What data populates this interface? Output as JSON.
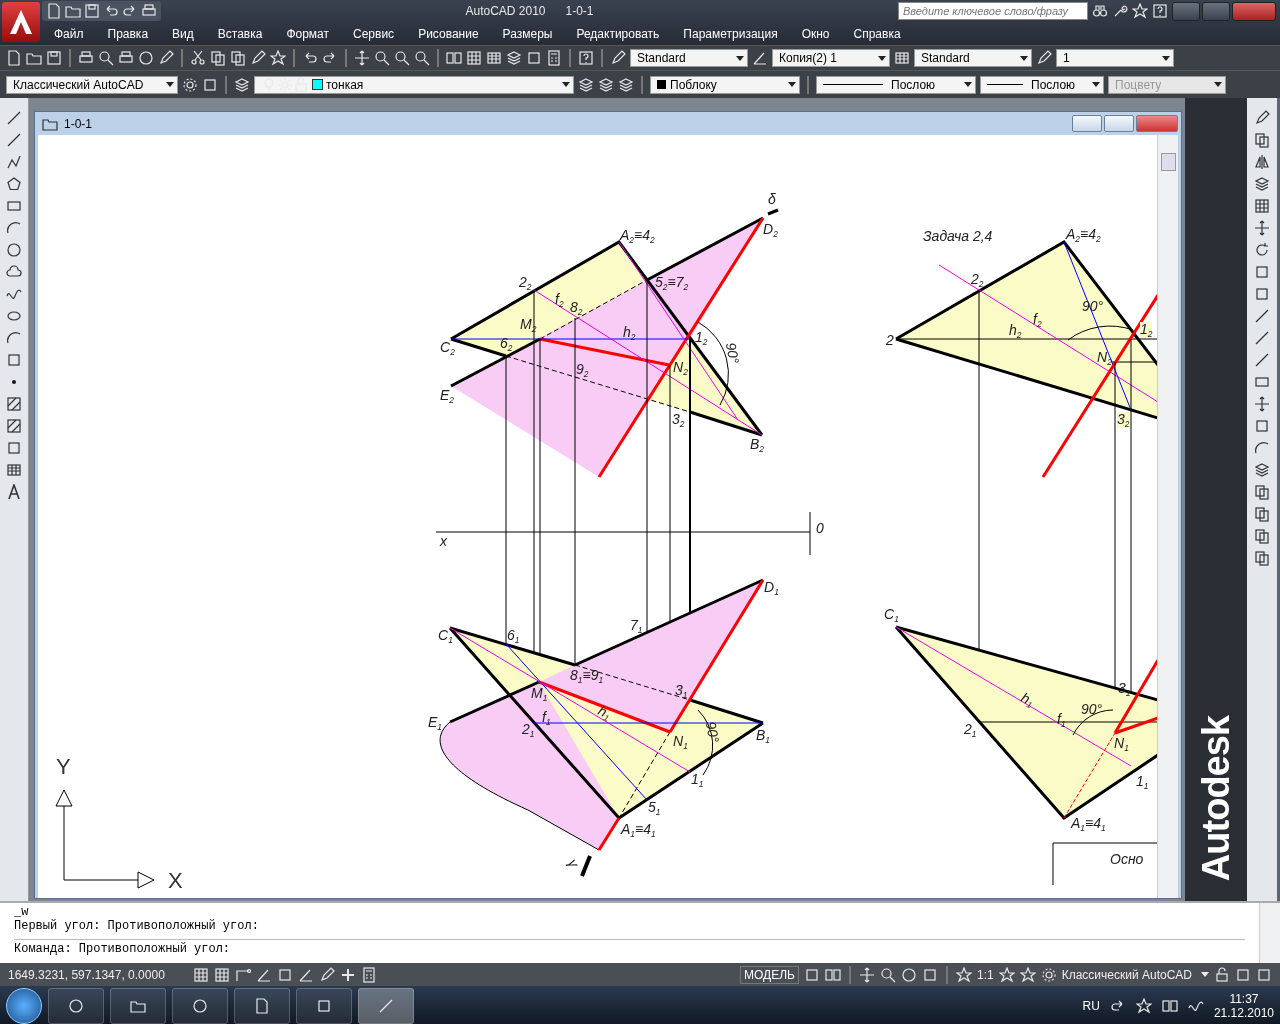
{
  "title_bar": {
    "title": "AutoCAD 2010",
    "document": "1-0-1",
    "search": {
      "placeholder": "Введите ключевое слово/фразу"
    }
  },
  "menu": [
    "Файл",
    "Правка",
    "Вид",
    "Вставка",
    "Формат",
    "Сервис",
    "Рисование",
    "Размеры",
    "Редактировать",
    "Параметризация",
    "Окно",
    "Справка"
  ],
  "styles_toolbar": {
    "text_style": "Standard",
    "dim_style": "Копия(2) 1",
    "table_style": "Standard",
    "multileader_scale": "1"
  },
  "properties_toolbar": {
    "workspace": "Классический AutoCAD",
    "layer": "тонкая",
    "object_color": "Поблоку",
    "linetype": "Послою",
    "lineweight": "Послою",
    "plot_style": {
      "value": "Поцвету",
      "disabled": true
    }
  },
  "drawing_window": {
    "title": "1-0-1",
    "labels": [
      "δ",
      "A$_{2}$≡4$_{2}$",
      "D$_{2}$",
      "2$_{2}$",
      "5$_{2}$≡7$_{2}$",
      "f$_{2}$",
      "8$_{2}$",
      "M$_{2}$",
      "h$_{2}$",
      "1$_{2}$",
      "C$_{2}$",
      "6$_{2}$",
      "90°",
      "N$_{2}$",
      "9$_{2}$",
      "E$_{2}$",
      "3$_{2}$",
      "B$_{2}$",
      "x",
      "0",
      "D$_{1}$",
      "7$_{1}$",
      "C$_{1}$",
      "6$_{1}$",
      "8$_{1}$≡9$_{1}$",
      "M$_{1}$",
      "3$_{1}$",
      "f$_{1}$",
      "h$_{1}$",
      "E$_{1}$",
      "2$_{1}$",
      "N$_{1}$",
      "B$_{1}$",
      "90°",
      "1$_{1}$",
      "5$_{1}$",
      "A$_{1}$≡4$_{1}$",
      "γ",
      "Задача 2,4",
      "A$_{2}$≡4$_{2}$",
      "2$_{2}$",
      "f$_{2}$",
      "90°",
      "2",
      "h$_{2}$",
      "1$_{2}$",
      "N$_{2}$",
      "3$_{2}$",
      "C$_{1}$",
      "3$_{1}$",
      "h$_{1}$",
      "2$_{1}$",
      "f$_{1}$",
      "90°",
      "N$_{1}$",
      "1$_{1}$",
      "A$_{1}$≡4$_{1}$",
      "Осно",
      "Y",
      "X"
    ]
  },
  "brand": "Autodesk",
  "command_line": {
    "history": [
      "_w",
      "Первый угол: Противоположный угол:"
    ],
    "prompt": "Команда: Противоположный угол:"
  },
  "status_bar": {
    "coordinates": "1649.3231, 597.1347, 0.0000",
    "space": "МОДЕЛЬ",
    "scale": "1:1",
    "workspace": "Классический AutoCAD"
  },
  "taskbar": {
    "language": "RU",
    "time": "11:37",
    "date": "21.12.2010"
  }
}
